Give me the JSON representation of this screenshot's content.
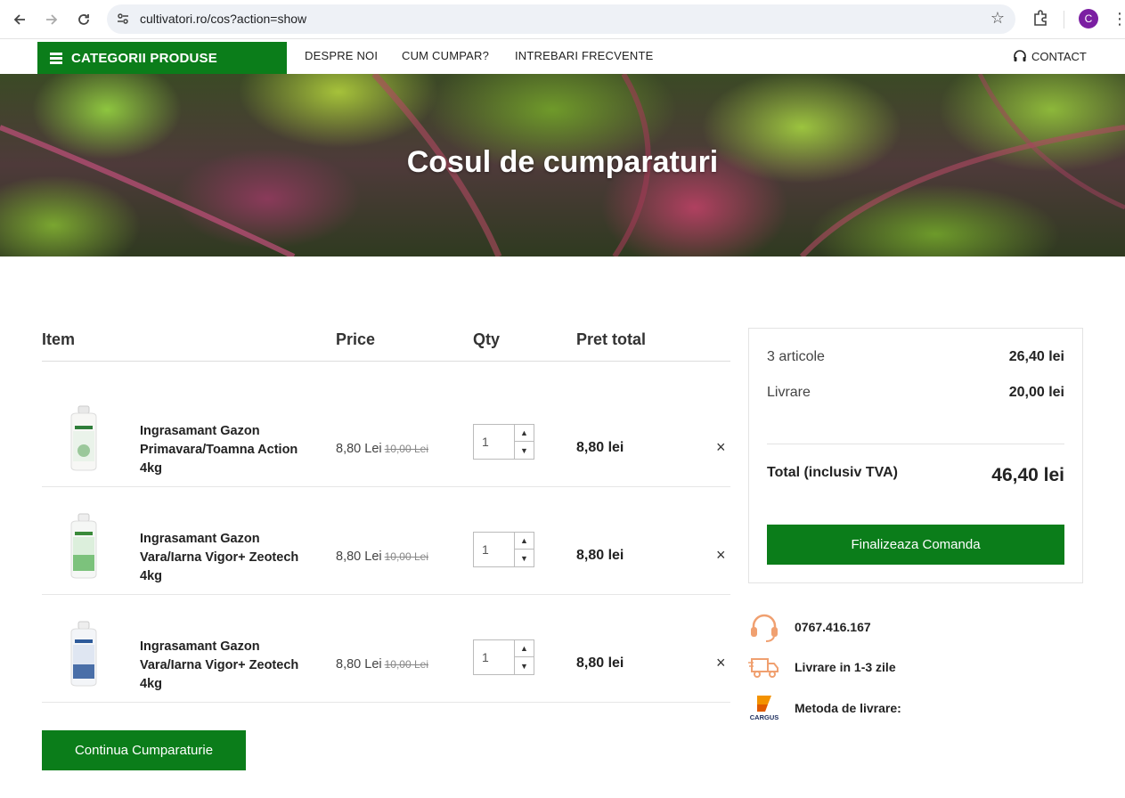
{
  "browser": {
    "url": "cultivatori.ro/cos?action=show",
    "avatar_letter": "C",
    "accent": "#7b1fa2"
  },
  "nav": {
    "categories": "CATEGORII PRODUSE",
    "links": [
      "DESPRE NOI",
      "CUM CUMPAR?",
      "INTREBARI FRECVENTE"
    ],
    "contact": "CONTACT",
    "brand_color": "#0b7d1a"
  },
  "hero": {
    "title": "Cosul de cumparaturi"
  },
  "cart": {
    "headers": {
      "item": "Item",
      "price": "Price",
      "qty": "Qty",
      "total": "Pret total"
    },
    "rows": [
      {
        "name": "Ingrasamant Gazon Primavara/Toamna Action 4kg",
        "price": "8,80 Lei",
        "old_price": "10,00 Lei",
        "qty": "1",
        "total": "8,80 lei",
        "remove": "×"
      },
      {
        "name": "Ingrasamant Gazon Vara/Iarna Vigor+ Zeotech 4kg",
        "price": "8,80 Lei",
        "old_price": "10,00 Lei",
        "qty": "1",
        "total": "8,80 lei",
        "remove": "×"
      },
      {
        "name": "Ingrasamant Gazon Vara/Iarna Vigor+ Zeotech 4kg",
        "price": "8,80 Lei",
        "old_price": "10,00 Lei",
        "qty": "1",
        "total": "8,80 lei",
        "remove": "×"
      }
    ],
    "continue_label": "Continua Cumparaturie"
  },
  "summary": {
    "items_label": "3 articole",
    "items_value": "26,40 lei",
    "shipping_label": "Livrare",
    "shipping_value": "20,00 lei",
    "total_label": "Total (inclusiv TVA)",
    "total_value": "46,40 lei",
    "finalize_label": "Finalizeaza Comanda"
  },
  "info": {
    "phone": "0767.416.167",
    "delivery": "Livrare in 1-3 zile",
    "method": "Metoda de livrare:",
    "courier_logo_text": "CARGUS"
  }
}
